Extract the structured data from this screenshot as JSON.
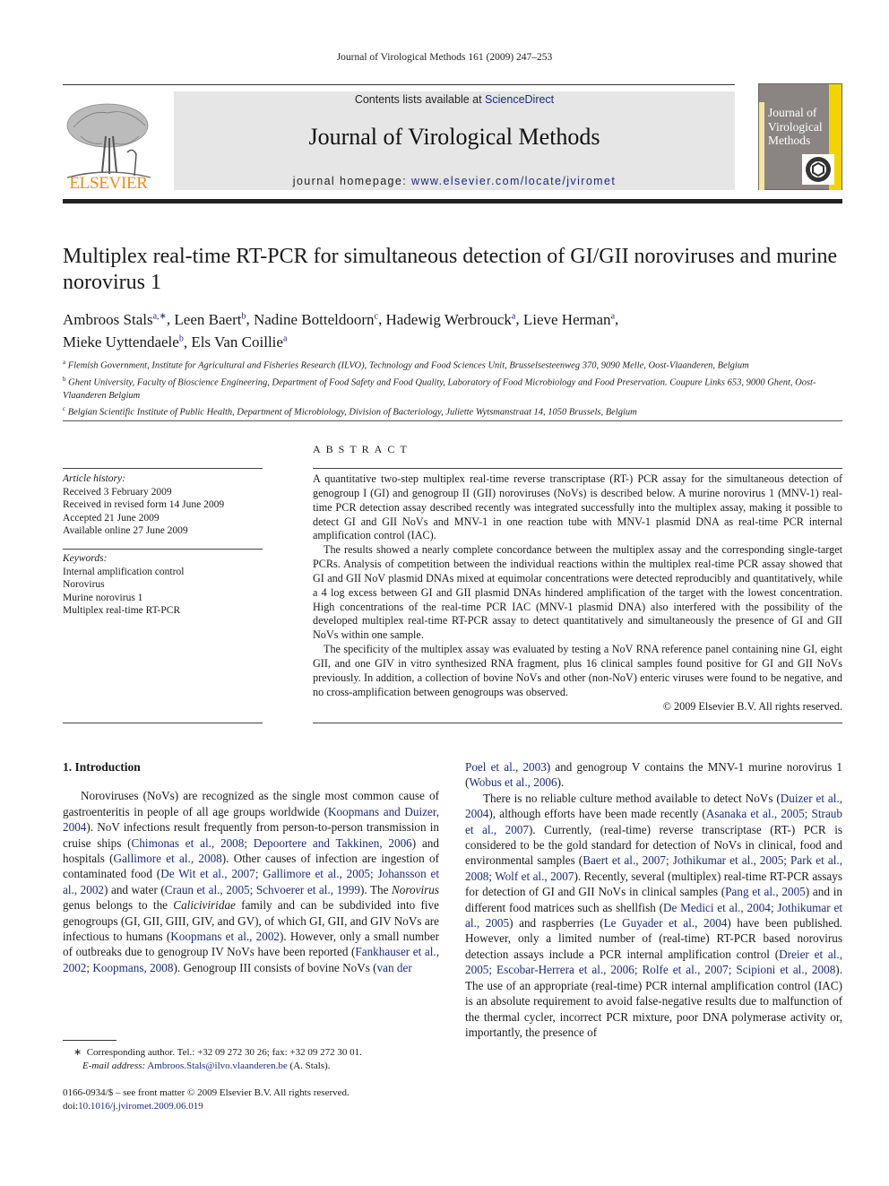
{
  "running_head": "Journal of Virological Methods 161 (2009) 247–253",
  "header": {
    "publisher_logo_label": "ELSEVIER",
    "contents_prefix": "Contents lists available at ",
    "contents_link": "ScienceDirect",
    "journal_title": "Journal of Virological Methods",
    "homepage_prefix": "journal homepage: ",
    "homepage_link": "www.elsevier.com/locate/jviromet",
    "cover_title_lines": [
      "Journal of",
      "Virological",
      "Methods"
    ],
    "colors": {
      "publisher_orange": "#f08a1c",
      "link_blue": "#1d2a80",
      "cover_yellow": "#f3d400",
      "cover_gray": "#8a8582"
    }
  },
  "article": {
    "title": "Multiplex real-time RT-PCR for simultaneous detection of GI/GII noroviruses and murine norovirus 1",
    "authors": [
      {
        "name": "Ambroos Stals",
        "sup": "a,∗",
        "sep": ", "
      },
      {
        "name": "Leen Baert",
        "sup": "b",
        "sep": ", "
      },
      {
        "name": "Nadine Botteldoorn",
        "sup": "c",
        "sep": ", "
      },
      {
        "name": "Hadewig Werbrouck",
        "sup": "a",
        "sep": ", "
      },
      {
        "name": "Lieve Herman",
        "sup": "a",
        "sep": ","
      },
      {
        "name": "Mieke Uyttendaele",
        "sup": "b",
        "sep": ", "
      },
      {
        "name": "Els Van Coillie",
        "sup": "a",
        "sep": ""
      }
    ],
    "affiliations": [
      {
        "key": "a",
        "text": "Flemish Government, Institute for Agricultural and Fisheries Research (ILVO), Technology and Food Sciences Unit, Brusselsesteenweg 370, 9090 Melle, Oost-Vlaanderen, Belgium"
      },
      {
        "key": "b",
        "text": "Ghent University, Faculty of Bioscience Engineering, Department of Food Safety and Food Quality, Laboratory of Food Microbiology and Food Preservation. Coupure Links 653, 9000 Ghent, Oost-Vlaanderen Belgium"
      },
      {
        "key": "c",
        "text": "Belgian Scientific Institute of Public Health, Department of Microbiology, Division of Bacteriology, Juliette Wytsmanstraat 14, 1050 Brussels, Belgium"
      }
    ]
  },
  "article_info": {
    "history_label": "Article history:",
    "history": [
      "Received 3 February 2009",
      "Received in revised form 14 June 2009",
      "Accepted 21 June 2009",
      "Available online 27 June 2009"
    ],
    "keywords_label": "Keywords:",
    "keywords": [
      "Internal amplification control",
      "Norovirus",
      "Murine norovirus 1",
      "Multiplex real-time RT-PCR"
    ]
  },
  "abstract": {
    "heading": "ABSTRACT",
    "paragraphs": [
      "A quantitative two-step multiplex real-time reverse transcriptase (RT-) PCR assay for the simultaneous detection of genogroup I (GI) and genogroup II (GII) noroviruses (NoVs) is described below. A murine norovirus 1 (MNV-1) real-time PCR detection assay described recently was integrated successfully into the multiplex assay, making it possible to detect GI and GII NoVs and MNV-1 in one reaction tube with MNV-1 plasmid DNA as real-time PCR internal amplification control (IAC).",
      "The results showed a nearly complete concordance between the multiplex assay and the corresponding single-target PCRs. Analysis of competition between the individual reactions within the multiplex real-time PCR assay showed that GI and GII NoV plasmid DNAs mixed at equimolar concentrations were detected reproducibly and quantitatively, while a 4 log excess between GI and GII plasmid DNAs hindered amplification of the target with the lowest concentration. High concentrations of the real-time PCR IAC (MNV-1 plasmid DNA) also interfered with the possibility of the developed multiplex real-time RT-PCR assay to detect quantitatively and simultaneously the presence of GI and GII NoVs within one sample.",
      "The specificity of the multiplex assay was evaluated by testing a NoV RNA reference panel containing nine GI, eight GII, and one GIV in vitro synthesized RNA fragment, plus 16 clinical samples found positive for GI and GII NoVs previously. In addition, a collection of bovine NoVs and other (non-NoV) enteric viruses were found to be negative, and no cross-amplification between genogroups was observed."
    ],
    "copyright": "© 2009 Elsevier B.V. All rights reserved."
  },
  "body": {
    "section_heading": "1.  Introduction",
    "left": {
      "p1": [
        {
          "t": "Noroviruses (NoVs) are recognized as the single most common cause of gastroenteritis in people of all age groups worldwide ("
        },
        {
          "l": "Koopmans and Duizer, 2004"
        },
        {
          "t": "). NoV infections result frequently from person-to-person transmission in cruise ships ("
        },
        {
          "l": "Chimonas et al., 2008; Depoortere and Takkinen, 2006"
        },
        {
          "t": ") and hospitals ("
        },
        {
          "l": "Gallimore et al., 2008"
        },
        {
          "t": "). Other causes of infection are ingestion of contaminated food ("
        },
        {
          "l": "De Wit et al., 2007; Gallimore et al., 2005; Johansson et al., 2002"
        },
        {
          "t": ") and water ("
        },
        {
          "l": "Craun et al., 2005; Schvoerer et al., 1999"
        },
        {
          "t": "). The "
        },
        {
          "i": "Norovirus"
        },
        {
          "t": " genus belongs to the "
        },
        {
          "i": "Caliciviridae"
        },
        {
          "t": " family and can be subdivided into five genogroups (GI, GII, GIII, GIV, and GV), of which GI, GII, and GIV NoVs are infectious to humans ("
        },
        {
          "l": "Koopmans et al., 2002"
        },
        {
          "t": "). However, only a small number of outbreaks due to genogroup IV NoVs have been reported ("
        },
        {
          "l": "Fankhauser et al., 2002; Koopmans, 2008"
        },
        {
          "t": "). Genogroup III consists of bovine NoVs ("
        },
        {
          "l": "van der"
        }
      ]
    },
    "right": {
      "p1": [
        {
          "l": "Poel et al., 2003"
        },
        {
          "t": ") and genogroup V contains the MNV-1 murine norovirus 1 ("
        },
        {
          "l": "Wobus et al., 2006"
        },
        {
          "t": ")."
        }
      ],
      "p2": [
        {
          "t": "There is no reliable culture method available to detect NoVs ("
        },
        {
          "l": "Duizer et al., 2004"
        },
        {
          "t": "), although efforts have been made recently ("
        },
        {
          "l": "Asanaka et al., 2005; Straub et al., 2007"
        },
        {
          "t": "). Currently, (real-time) reverse transcriptase (RT-) PCR is considered to be the gold standard for detection of NoVs in clinical, food and environmental samples ("
        },
        {
          "l": "Baert et al., 2007; Jothikumar et al., 2005; Park et al., 2008; Wolf et al., 2007"
        },
        {
          "t": "). Recently, several (multiplex) real-time RT-PCR assays for detection of GI and GII NoVs in clinical samples ("
        },
        {
          "l": "Pang et al., 2005"
        },
        {
          "t": ") and in different food matrices such as shellfish ("
        },
        {
          "l": "De Medici et al., 2004; Jothikumar et al., 2005"
        },
        {
          "t": ") and raspberries ("
        },
        {
          "l": "Le Guyader et al., 2004"
        },
        {
          "t": ") have been published. However, only a limited number of (real-time) RT-PCR based norovirus detection assays include a PCR internal amplification control ("
        },
        {
          "l": "Dreier et al., 2005; Escobar-Herrera et al., 2006; Rolfe et al., 2007; Scipioni et al., 2008"
        },
        {
          "t": "). The use of an appropriate (real-time) PCR internal amplification control (IAC) is an absolute requirement to avoid false-negative results due to malfunction of the thermal cycler, incorrect PCR mixture, poor DNA polymerase activity or, importantly, the presence of"
        }
      ]
    }
  },
  "footnote": {
    "marker": "∗",
    "corresponding": "Corresponding author. Tel.: +32 09 272 30 26; fax: +32 09 272 30 01.",
    "email_label": "E-mail address:",
    "email": "Ambroos.Stals@ilvo.vlaanderen.be",
    "email_suffix": " (A. Stals)."
  },
  "front_matter": {
    "issn_line": "0166-0934/$ – see front matter © 2009 Elsevier B.V. All rights reserved.",
    "doi_prefix": "doi:",
    "doi": "10.1016/j.jviromet.2009.06.019"
  }
}
